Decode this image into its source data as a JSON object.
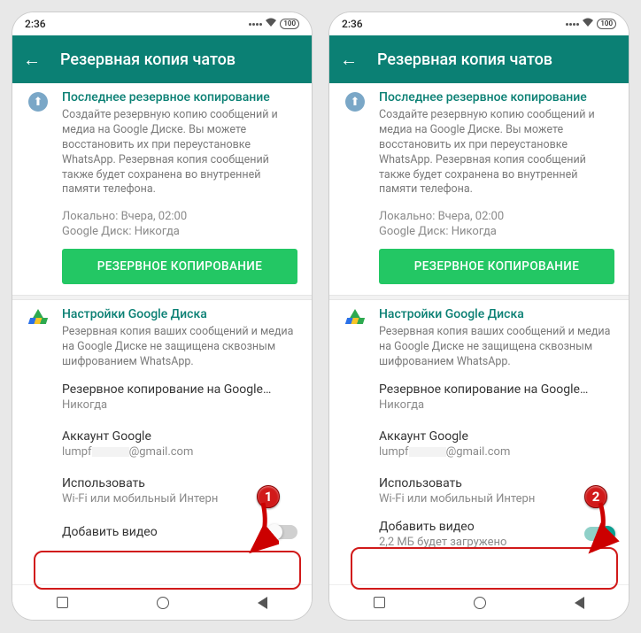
{
  "status": {
    "time": "2:36",
    "battery": "100"
  },
  "header": {
    "title": "Резервная копия чатов"
  },
  "backup": {
    "section_title": "Последнее резервное копирование",
    "desc": "Создайте резервную копию сообщений и медиа на Google Диске. Вы можете восстановить их при переустановке WhatsApp. Резервная копия сообщений также будет сохранена во внутренней памяти телефона.",
    "local_label": "Локально: Вчера, 02:00",
    "gdrive_label": "Google Диск: Никогда",
    "button": "РЕЗЕРВНОЕ КОПИРОВАНИЕ"
  },
  "gdrive": {
    "section_title": "Настройки Google Диска",
    "desc": "Резервная копия ваших сообщений и медиа на Google Диске не защищена сквозным шифрованием WhatsApp.",
    "freq_title": "Резервное копирование на Google…",
    "freq_value": "Никогда",
    "account_title": "Аккаунт Google",
    "account_value_prefix": "lumpf",
    "account_value_suffix": "@gmail.com",
    "network_title": "Использовать",
    "network_value": "Wi-Fi или мобильный Интерн"
  },
  "video_off": {
    "title": "Добавить видео"
  },
  "video_on": {
    "title": "Добавить видео",
    "sub": "2,2 МБ будет загружено"
  },
  "badges": {
    "left": "1",
    "right": "2"
  }
}
